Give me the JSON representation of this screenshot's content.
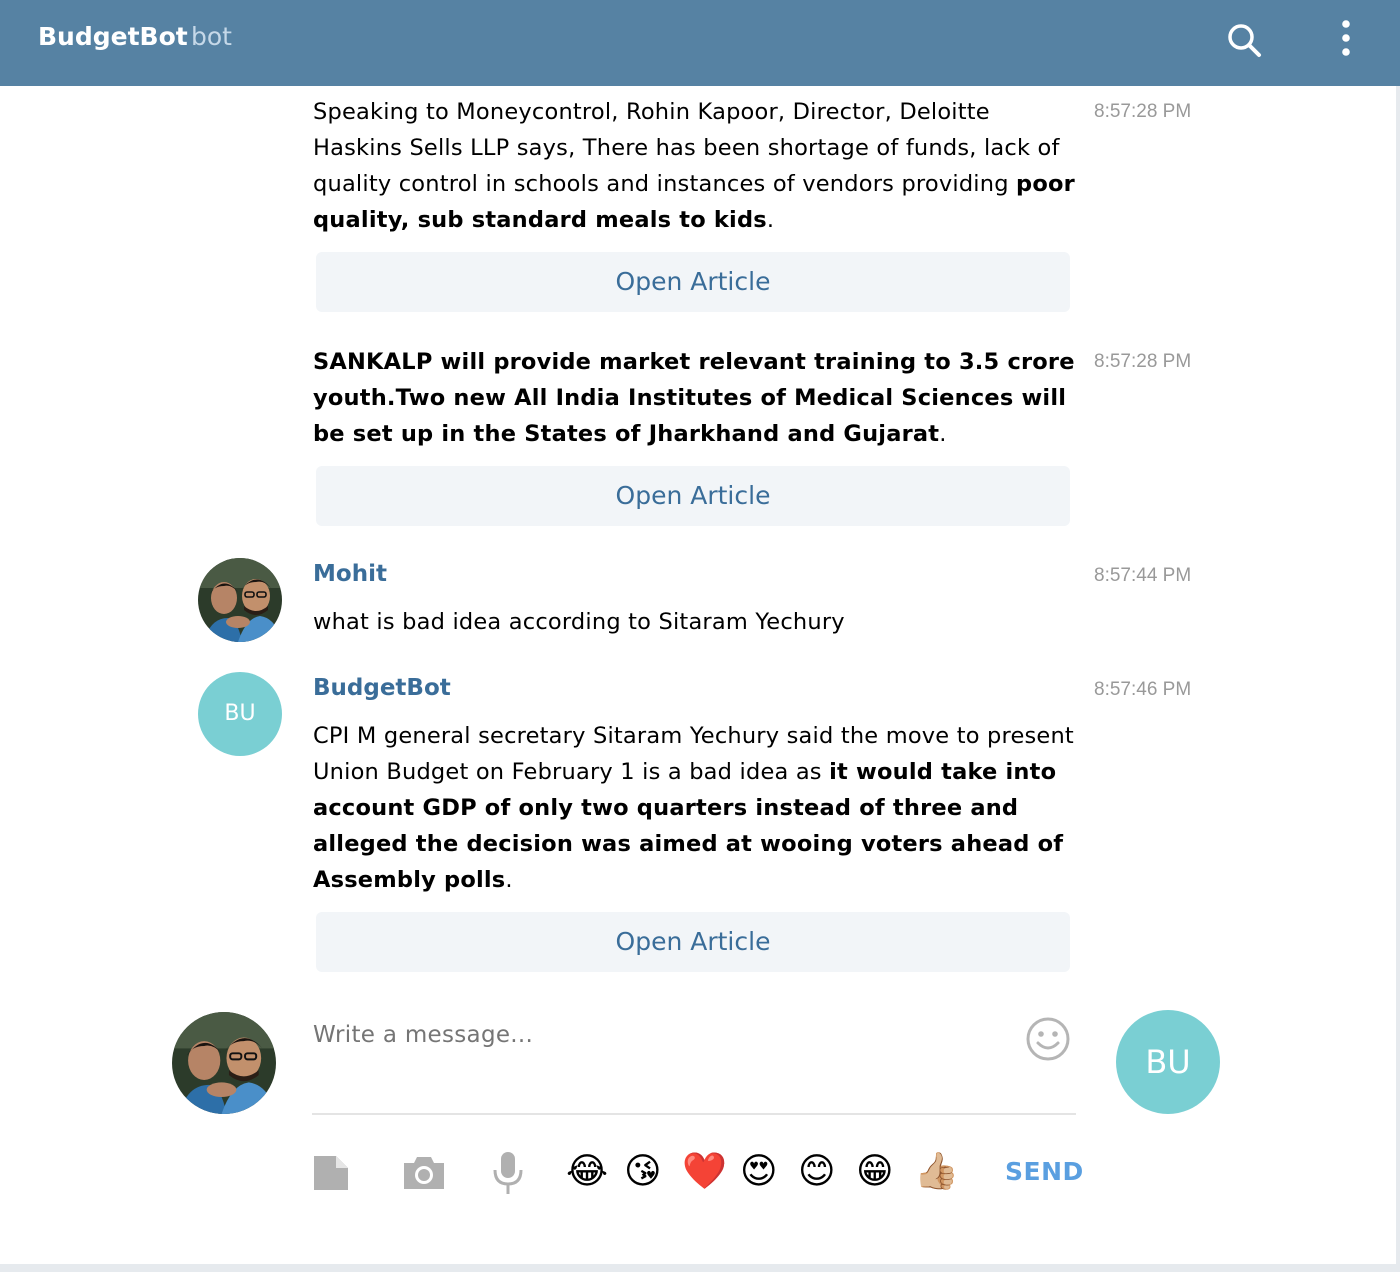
{
  "header": {
    "title": "BudgetBot",
    "subtitle": "bot",
    "icons": [
      "search-icon",
      "more-vertical-icon"
    ]
  },
  "messages": [
    {
      "time": "8:57:28 PM",
      "text_plain": "Speaking to Moneycontrol, Rohin Kapoor, Director, Deloitte Haskins Sells LLP says, There has been shortage of funds, lack of quality control in schools and instances of vendors providing ",
      "text_bold": "poor quality, sub standard meals to kids",
      "text_end": ".",
      "button": "Open Article"
    },
    {
      "time": "8:57:28 PM",
      "text_bold": "SANKALP will provide market relevant training to 3.5 crore youth.Two new All India Institutes of Medical Sciences will be set up in the States of Jharkhand and Gujarat",
      "text_end": ".",
      "button": "Open Article"
    },
    {
      "sender": "Mohit",
      "time": "8:57:44 PM",
      "text": "what is bad idea according to Sitaram Yechury"
    },
    {
      "sender": "BudgetBot",
      "avatar_initials": "BU",
      "time": "8:57:46 PM",
      "text_plain": "CPI M general secretary Sitaram Yechury said the move to present Union Budget on February 1 is a bad idea as ",
      "text_bold": "it would take into account GDP of only two quarters instead of three and alleged the decision was aimed at wooing voters ahead of Assembly polls",
      "text_end": ".",
      "button": "Open Article"
    }
  ],
  "composer": {
    "placeholder": "Write a message...",
    "send_label": "SEND",
    "bot_avatar_initials": "BU",
    "tools": [
      "attach-file-icon",
      "camera-icon",
      "microphone-icon"
    ],
    "emoji": [
      "😂",
      "😘",
      "❤️",
      "😍",
      "😊",
      "😁",
      "👍🏼"
    ]
  },
  "colors": {
    "header_bg": "#5682a3",
    "link": "#3a6d99",
    "bot_avatar": "#7acfd3",
    "send": "#5a9fe0",
    "button_bg": "#f2f5f8"
  }
}
